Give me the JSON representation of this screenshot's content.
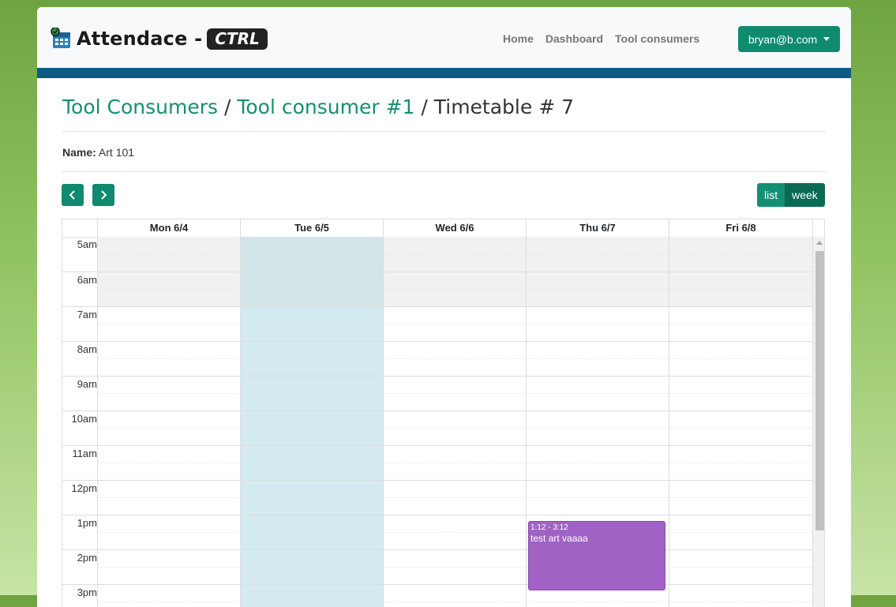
{
  "brand": {
    "name": "Attendace -",
    "tag": "CTRL"
  },
  "nav": {
    "links": [
      "Home",
      "Dashboard",
      "Tool consumers"
    ],
    "user": "bryan@b.com"
  },
  "breadcrumb": {
    "root": "Tool Consumers",
    "sep1": " / ",
    "parent": "Tool consumer #1",
    "sep2": " / ",
    "current": "Timetable # 7"
  },
  "details": {
    "name_label": "Name:",
    "name_value": "Art 101"
  },
  "calendar": {
    "view_buttons": {
      "list": "list",
      "week": "week"
    },
    "active_view": "week",
    "days": [
      "Mon 6/4",
      "Tue 6/5",
      "Wed 6/6",
      "Thu 6/7",
      "Fri 6/8"
    ],
    "today": "Tue 6/5",
    "hours": [
      "5am",
      "6am",
      "7am",
      "8am",
      "9am",
      "10am",
      "11am",
      "12pm",
      "1pm",
      "2pm",
      "3pm"
    ],
    "event": {
      "time": "1:12 - 3:12",
      "title": "test art vaaaa",
      "color": "#a062c4",
      "day": "Thu 6/7"
    }
  },
  "colors": {
    "primary": "#0f8a6e",
    "link": "#158f6f",
    "stripe": "#0e5a86",
    "today": "#d3eaf0"
  }
}
